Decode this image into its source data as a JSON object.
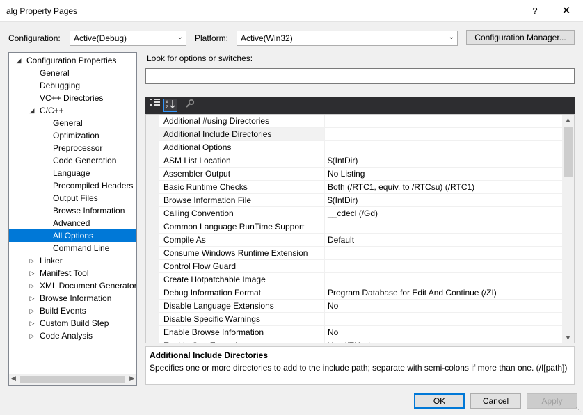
{
  "window": {
    "title": "alg Property Pages",
    "help_label": "?",
    "close_label": "✕"
  },
  "config_bar": {
    "configuration_label": "Configuration:",
    "configuration_value": "Active(Debug)",
    "platform_label": "Platform:",
    "platform_value": "Active(Win32)",
    "manager_button": "Configuration Manager..."
  },
  "tree": {
    "items": [
      {
        "label": "Configuration Properties",
        "expander": "◢"
      },
      {
        "label": "General",
        "expander": ""
      },
      {
        "label": "Debugging",
        "expander": ""
      },
      {
        "label": "VC++ Directories",
        "expander": ""
      },
      {
        "label": "C/C++",
        "expander": "◢"
      },
      {
        "label": "General",
        "expander": ""
      },
      {
        "label": "Optimization",
        "expander": ""
      },
      {
        "label": "Preprocessor",
        "expander": ""
      },
      {
        "label": "Code Generation",
        "expander": ""
      },
      {
        "label": "Language",
        "expander": ""
      },
      {
        "label": "Precompiled Headers",
        "expander": ""
      },
      {
        "label": "Output Files",
        "expander": ""
      },
      {
        "label": "Browse Information",
        "expander": ""
      },
      {
        "label": "Advanced",
        "expander": ""
      },
      {
        "label": "All Options",
        "expander": ""
      },
      {
        "label": "Command Line",
        "expander": ""
      },
      {
        "label": "Linker",
        "expander": "▷"
      },
      {
        "label": "Manifest Tool",
        "expander": "▷"
      },
      {
        "label": "XML Document Generator",
        "expander": "▷"
      },
      {
        "label": "Browse Information",
        "expander": "▷"
      },
      {
        "label": "Build Events",
        "expander": "▷"
      },
      {
        "label": "Custom Build Step",
        "expander": "▷"
      },
      {
        "label": "Code Analysis",
        "expander": "▷"
      }
    ],
    "selected_index": 14
  },
  "search": {
    "label": "Look for options or switches:",
    "value": ""
  },
  "toolbar": {
    "categorized_icon": "categorized-icon",
    "alphabetical_icon": "sort-alphabetical-icon",
    "property_pages_icon": "wrench-icon"
  },
  "grid": {
    "rows": [
      {
        "name": "Additional #using Directories",
        "value": ""
      },
      {
        "name": "Additional Include Directories",
        "value": ""
      },
      {
        "name": "Additional Options",
        "value": ""
      },
      {
        "name": "ASM List Location",
        "value": "$(IntDir)"
      },
      {
        "name": "Assembler Output",
        "value": "No Listing"
      },
      {
        "name": "Basic Runtime Checks",
        "value": "Both (/RTC1, equiv. to /RTCsu) (/RTC1)"
      },
      {
        "name": "Browse Information File",
        "value": "$(IntDir)"
      },
      {
        "name": "Calling Convention",
        "value": "__cdecl (/Gd)"
      },
      {
        "name": "Common Language RunTime Support",
        "value": ""
      },
      {
        "name": "Compile As",
        "value": "Default"
      },
      {
        "name": "Consume Windows Runtime Extension",
        "value": ""
      },
      {
        "name": "Control Flow Guard",
        "value": ""
      },
      {
        "name": "Create Hotpatchable Image",
        "value": ""
      },
      {
        "name": "Debug Information Format",
        "value": "Program Database for Edit And Continue (/ZI)"
      },
      {
        "name": "Disable Language Extensions",
        "value": "No"
      },
      {
        "name": "Disable Specific Warnings",
        "value": ""
      },
      {
        "name": "Enable Browse Information",
        "value": "No"
      },
      {
        "name": "Enable C++ Exceptions",
        "value": "Yes (/EHsc)"
      }
    ],
    "selected_index": 1
  },
  "description": {
    "title": "Additional Include Directories",
    "text": "Specifies one or more directories to add to the include path; separate with semi-colons if more than one. (/I[path])"
  },
  "buttons": {
    "ok": "OK",
    "cancel": "Cancel",
    "apply": "Apply"
  },
  "colors": {
    "selection": "#0078d7",
    "toolbar_bg": "#2d2d30",
    "dialog_bg": "#f0f0f0"
  }
}
